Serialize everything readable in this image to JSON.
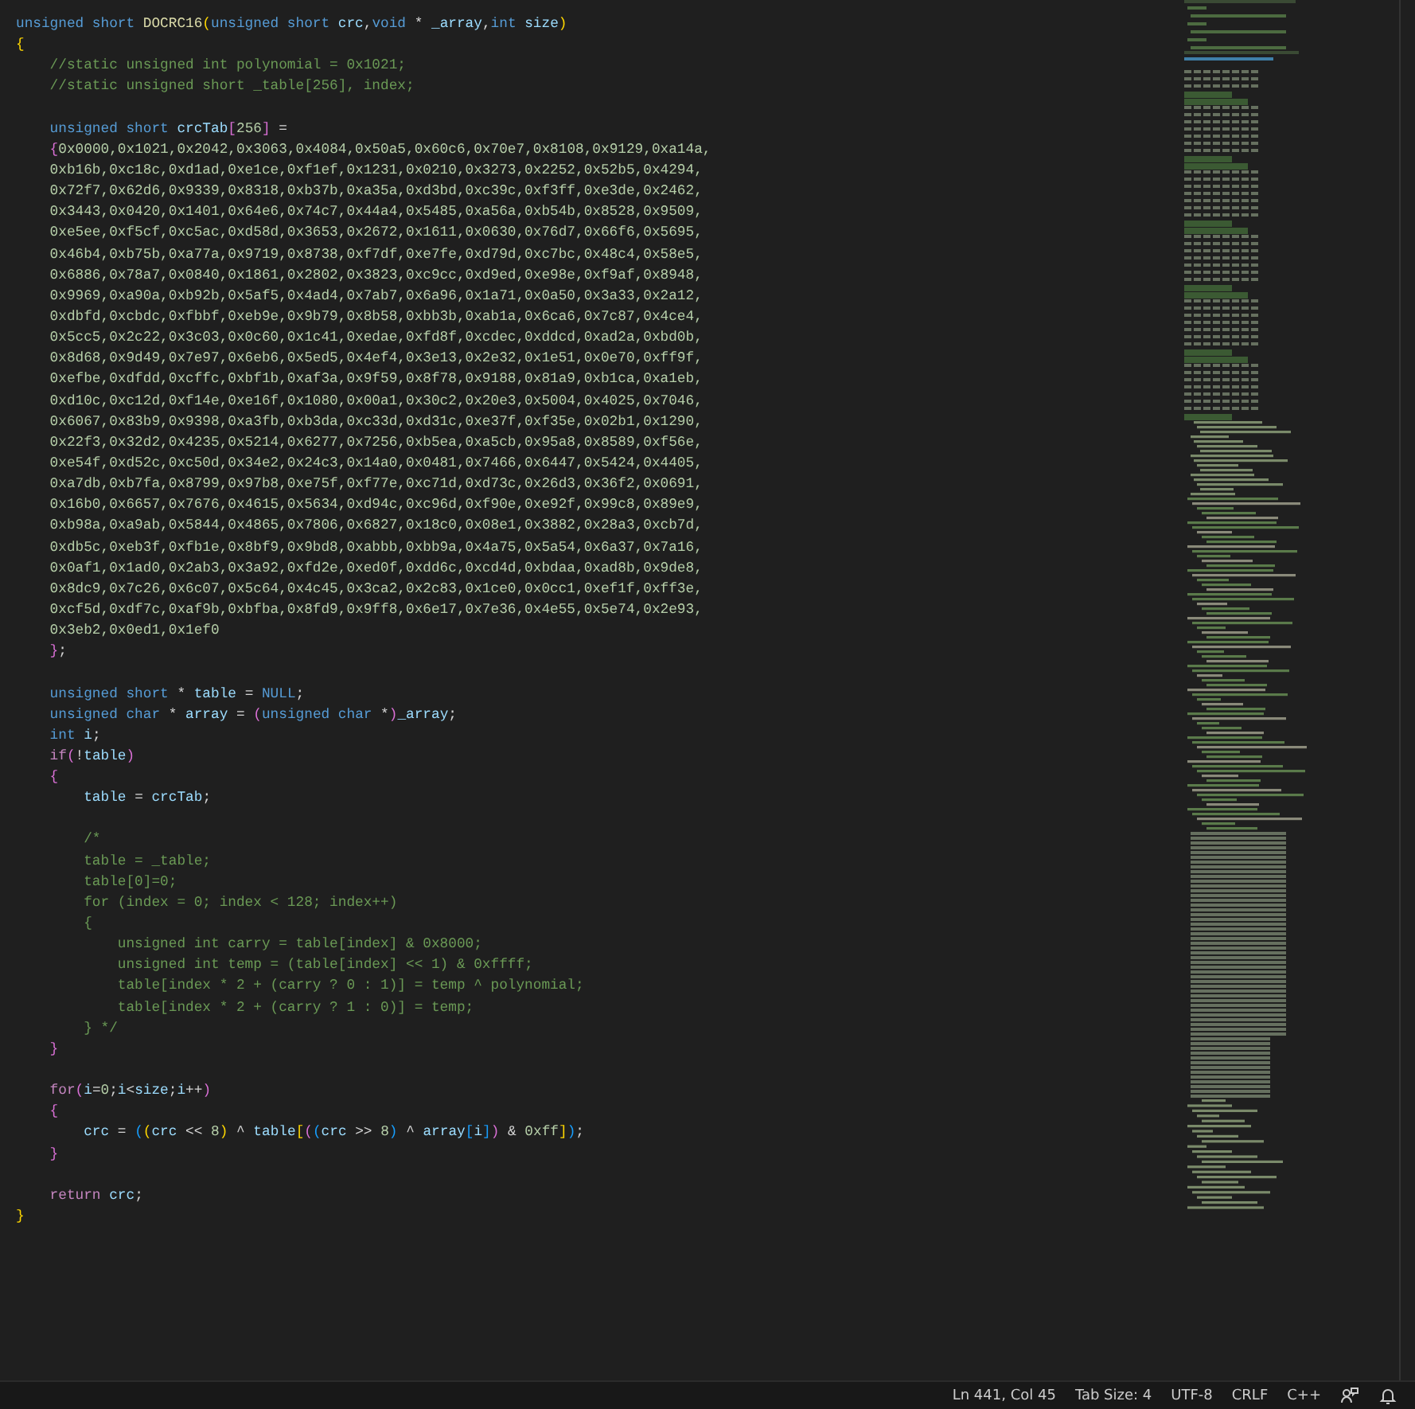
{
  "editor": {
    "lines": [
      {
        "kind": "code",
        "tokens": [
          {
            "kind": "kw",
            "text": "unsigned short "
          },
          {
            "kind": "fn",
            "text": "DOCRC16"
          },
          {
            "kind": "b1",
            "text": "("
          },
          {
            "kind": "kw",
            "text": "unsigned short "
          },
          {
            "kind": "var",
            "text": "crc"
          },
          {
            "kind": "op",
            "text": ","
          },
          {
            "kind": "kw",
            "text": "void"
          },
          {
            "kind": "op",
            "text": " * "
          },
          {
            "kind": "var",
            "text": "_array"
          },
          {
            "kind": "op",
            "text": ","
          },
          {
            "kind": "kw",
            "text": "int "
          },
          {
            "kind": "var",
            "text": "size"
          },
          {
            "kind": "b1",
            "text": ")"
          }
        ]
      },
      {
        "kind": "code",
        "tokens": [
          {
            "kind": "b1",
            "text": "{"
          }
        ]
      },
      {
        "kind": "code",
        "tokens": [
          {
            "kind": "cm",
            "text": "    //static unsigned int polynomial = 0x1021;"
          }
        ]
      },
      {
        "kind": "code",
        "tokens": [
          {
            "kind": "cm",
            "text": "    //static unsigned short _table[256], index;"
          }
        ]
      },
      {
        "kind": "blank"
      },
      {
        "kind": "code",
        "tokens": [
          {
            "kind": "kw",
            "text": "    unsigned short "
          },
          {
            "kind": "var",
            "text": "crcTab"
          },
          {
            "kind": "b2",
            "text": "["
          },
          {
            "kind": "num",
            "text": "256"
          },
          {
            "kind": "b2",
            "text": "]"
          },
          {
            "kind": "op",
            "text": " ="
          }
        ]
      },
      {
        "kind": "code",
        "tokens": [
          {
            "kind": "b2",
            "text": "    {"
          },
          {
            "kind": "num",
            "text": "0x0000,0x1021,0x2042,0x3063,0x4084,0x50a5,0x60c6,0x70e7,0x8108,0x9129,0xa14a,"
          }
        ]
      },
      {
        "kind": "code",
        "tokens": [
          {
            "kind": "num",
            "text": "    0xb16b,0xc18c,0xd1ad,0xe1ce,0xf1ef,0x1231,0x0210,0x3273,0x2252,0x52b5,0x4294,"
          }
        ]
      },
      {
        "kind": "code",
        "tokens": [
          {
            "kind": "num",
            "text": "    0x72f7,0x62d6,0x9339,0x8318,0xb37b,0xa35a,0xd3bd,0xc39c,0xf3ff,0xe3de,0x2462,"
          }
        ]
      },
      {
        "kind": "code",
        "tokens": [
          {
            "kind": "num",
            "text": "    0x3443,0x0420,0x1401,0x64e6,0x74c7,0x44a4,0x5485,0xa56a,0xb54b,0x8528,0x9509,"
          }
        ]
      },
      {
        "kind": "code",
        "tokens": [
          {
            "kind": "num",
            "text": "    0xe5ee,0xf5cf,0xc5ac,0xd58d,0x3653,0x2672,0x1611,0x0630,0x76d7,0x66f6,0x5695,"
          }
        ]
      },
      {
        "kind": "code",
        "tokens": [
          {
            "kind": "num",
            "text": "    0x46b4,0xb75b,0xa77a,0x9719,0x8738,0xf7df,0xe7fe,0xd79d,0xc7bc,0x48c4,0x58e5,"
          }
        ]
      },
      {
        "kind": "code",
        "tokens": [
          {
            "kind": "num",
            "text": "    0x6886,0x78a7,0x0840,0x1861,0x2802,0x3823,0xc9cc,0xd9ed,0xe98e,0xf9af,0x8948,"
          }
        ]
      },
      {
        "kind": "code",
        "tokens": [
          {
            "kind": "num",
            "text": "    0x9969,0xa90a,0xb92b,0x5af5,0x4ad4,0x7ab7,0x6a96,0x1a71,0x0a50,0x3a33,0x2a12,"
          }
        ]
      },
      {
        "kind": "code",
        "tokens": [
          {
            "kind": "num",
            "text": "    0xdbfd,0xcbdc,0xfbbf,0xeb9e,0x9b79,0x8b58,0xbb3b,0xab1a,0x6ca6,0x7c87,0x4ce4,"
          }
        ]
      },
      {
        "kind": "code",
        "tokens": [
          {
            "kind": "num",
            "text": "    0x5cc5,0x2c22,0x3c03,0x0c60,0x1c41,0xedae,0xfd8f,0xcdec,0xddcd,0xad2a,0xbd0b,"
          }
        ]
      },
      {
        "kind": "code",
        "tokens": [
          {
            "kind": "num",
            "text": "    0x8d68,0x9d49,0x7e97,0x6eb6,0x5ed5,0x4ef4,0x3e13,0x2e32,0x1e51,0x0e70,0xff9f,"
          }
        ]
      },
      {
        "kind": "code",
        "tokens": [
          {
            "kind": "num",
            "text": "    0xefbe,0xdfdd,0xcffc,0xbf1b,0xaf3a,0x9f59,0x8f78,0x9188,0x81a9,0xb1ca,0xa1eb,"
          }
        ]
      },
      {
        "kind": "code",
        "tokens": [
          {
            "kind": "num",
            "text": "    0xd10c,0xc12d,0xf14e,0xe16f,0x1080,0x00a1,0x30c2,0x20e3,0x5004,0x4025,0x7046,"
          }
        ]
      },
      {
        "kind": "code",
        "tokens": [
          {
            "kind": "num",
            "text": "    0x6067,0x83b9,0x9398,0xa3fb,0xb3da,0xc33d,0xd31c,0xe37f,0xf35e,0x02b1,0x1290,"
          }
        ]
      },
      {
        "kind": "code",
        "tokens": [
          {
            "kind": "num",
            "text": "    0x22f3,0x32d2,0x4235,0x5214,0x6277,0x7256,0xb5ea,0xa5cb,0x95a8,0x8589,0xf56e,"
          }
        ]
      },
      {
        "kind": "code",
        "tokens": [
          {
            "kind": "num",
            "text": "    0xe54f,0xd52c,0xc50d,0x34e2,0x24c3,0x14a0,0x0481,0x7466,0x6447,0x5424,0x4405,"
          }
        ]
      },
      {
        "kind": "code",
        "tokens": [
          {
            "kind": "num",
            "text": "    0xa7db,0xb7fa,0x8799,0x97b8,0xe75f,0xf77e,0xc71d,0xd73c,0x26d3,0x36f2,0x0691,"
          }
        ]
      },
      {
        "kind": "code",
        "tokens": [
          {
            "kind": "num",
            "text": "    0x16b0,0x6657,0x7676,0x4615,0x5634,0xd94c,0xc96d,0xf90e,0xe92f,0x99c8,0x89e9,"
          }
        ]
      },
      {
        "kind": "code",
        "tokens": [
          {
            "kind": "num",
            "text": "    0xb98a,0xa9ab,0x5844,0x4865,0x7806,0x6827,0x18c0,0x08e1,0x3882,0x28a3,0xcb7d,"
          }
        ]
      },
      {
        "kind": "code",
        "tokens": [
          {
            "kind": "num",
            "text": "    0xdb5c,0xeb3f,0xfb1e,0x8bf9,0x9bd8,0xabbb,0xbb9a,0x4a75,0x5a54,0x6a37,0x7a16,"
          }
        ]
      },
      {
        "kind": "code",
        "tokens": [
          {
            "kind": "num",
            "text": "    0x0af1,0x1ad0,0x2ab3,0x3a92,0xfd2e,0xed0f,0xdd6c,0xcd4d,0xbdaa,0xad8b,0x9de8,"
          }
        ]
      },
      {
        "kind": "code",
        "tokens": [
          {
            "kind": "num",
            "text": "    0x8dc9,0x7c26,0x6c07,0x5c64,0x4c45,0x3ca2,0x2c83,0x1ce0,0x0cc1,0xef1f,0xff3e,"
          }
        ]
      },
      {
        "kind": "code",
        "tokens": [
          {
            "kind": "num",
            "text": "    0xcf5d,0xdf7c,0xaf9b,0xbfba,0x8fd9,0x9ff8,0x6e17,0x7e36,0x4e55,0x5e74,0x2e93,"
          }
        ]
      },
      {
        "kind": "code",
        "tokens": [
          {
            "kind": "num",
            "text": "    0x3eb2,0x0ed1,0x1ef0"
          }
        ]
      },
      {
        "kind": "code",
        "tokens": [
          {
            "kind": "b2",
            "text": "    }"
          },
          {
            "kind": "op",
            "text": ";"
          }
        ]
      },
      {
        "kind": "blank"
      },
      {
        "kind": "code",
        "tokens": [
          {
            "kind": "kw",
            "text": "    unsigned short"
          },
          {
            "kind": "op",
            "text": " * "
          },
          {
            "kind": "var",
            "text": "table"
          },
          {
            "kind": "op",
            "text": " = "
          },
          {
            "kind": "kw",
            "text": "NULL"
          },
          {
            "kind": "op",
            "text": ";"
          }
        ]
      },
      {
        "kind": "code",
        "tokens": [
          {
            "kind": "kw",
            "text": "    unsigned char"
          },
          {
            "kind": "op",
            "text": " * "
          },
          {
            "kind": "var",
            "text": "array"
          },
          {
            "kind": "op",
            "text": " = "
          },
          {
            "kind": "b2",
            "text": "("
          },
          {
            "kind": "kw",
            "text": "unsigned char "
          },
          {
            "kind": "op",
            "text": "*"
          },
          {
            "kind": "b2",
            "text": ")"
          },
          {
            "kind": "var",
            "text": "_array"
          },
          {
            "kind": "op",
            "text": ";"
          }
        ]
      },
      {
        "kind": "code",
        "tokens": [
          {
            "kind": "kw",
            "text": "    int "
          },
          {
            "kind": "var",
            "text": "i"
          },
          {
            "kind": "op",
            "text": ";"
          }
        ]
      },
      {
        "kind": "code",
        "tokens": [
          {
            "kind": "ctl",
            "text": "    if"
          },
          {
            "kind": "b2",
            "text": "("
          },
          {
            "kind": "op",
            "text": "!"
          },
          {
            "kind": "var",
            "text": "table"
          },
          {
            "kind": "b2",
            "text": ")"
          }
        ]
      },
      {
        "kind": "code",
        "tokens": [
          {
            "kind": "b2",
            "text": "    {"
          }
        ]
      },
      {
        "kind": "code",
        "tokens": [
          {
            "kind": "var",
            "text": "        table"
          },
          {
            "kind": "op",
            "text": " = "
          },
          {
            "kind": "var",
            "text": "crcTab"
          },
          {
            "kind": "op",
            "text": ";"
          }
        ]
      },
      {
        "kind": "blank"
      },
      {
        "kind": "code",
        "tokens": [
          {
            "kind": "cm",
            "text": "        /*"
          }
        ]
      },
      {
        "kind": "code",
        "tokens": [
          {
            "kind": "cm",
            "text": "        table = _table;"
          }
        ]
      },
      {
        "kind": "code",
        "tokens": [
          {
            "kind": "cm",
            "text": "        table[0]=0;"
          }
        ]
      },
      {
        "kind": "code",
        "tokens": [
          {
            "kind": "cm",
            "text": "        for (index = 0; index < 128; index++)"
          }
        ]
      },
      {
        "kind": "code",
        "tokens": [
          {
            "kind": "cm",
            "text": "        {"
          }
        ]
      },
      {
        "kind": "code",
        "tokens": [
          {
            "kind": "cm",
            "text": "            unsigned int carry = table[index] & 0x8000;"
          }
        ]
      },
      {
        "kind": "code",
        "tokens": [
          {
            "kind": "cm",
            "text": "            unsigned int temp = (table[index] << 1) & 0xffff;"
          }
        ]
      },
      {
        "kind": "code",
        "tokens": [
          {
            "kind": "cm",
            "text": "            table[index * 2 + (carry ? 0 : 1)] = temp ^ polynomial;"
          }
        ]
      },
      {
        "kind": "code",
        "tokens": [
          {
            "kind": "cm",
            "text": "            table[index * 2 + (carry ? 1 : 0)] = temp;"
          }
        ]
      },
      {
        "kind": "code",
        "tokens": [
          {
            "kind": "cm",
            "text": "        } */"
          }
        ]
      },
      {
        "kind": "code",
        "tokens": [
          {
            "kind": "b2",
            "text": "    }"
          }
        ]
      },
      {
        "kind": "blank"
      },
      {
        "kind": "code",
        "tokens": [
          {
            "kind": "ctl",
            "text": "    for"
          },
          {
            "kind": "b2",
            "text": "("
          },
          {
            "kind": "var",
            "text": "i"
          },
          {
            "kind": "op",
            "text": "="
          },
          {
            "kind": "num",
            "text": "0"
          },
          {
            "kind": "op",
            "text": ";"
          },
          {
            "kind": "var",
            "text": "i"
          },
          {
            "kind": "op",
            "text": "<"
          },
          {
            "kind": "var",
            "text": "size"
          },
          {
            "kind": "op",
            "text": ";"
          },
          {
            "kind": "var",
            "text": "i"
          },
          {
            "kind": "op",
            "text": "++"
          },
          {
            "kind": "b2",
            "text": ")"
          }
        ]
      },
      {
        "kind": "code",
        "tokens": [
          {
            "kind": "b2",
            "text": "    {"
          }
        ]
      },
      {
        "kind": "code",
        "tokens": [
          {
            "kind": "var",
            "text": "        crc"
          },
          {
            "kind": "op",
            "text": " = "
          },
          {
            "kind": "b3",
            "text": "("
          },
          {
            "kind": "b1",
            "text": "("
          },
          {
            "kind": "var",
            "text": "crc"
          },
          {
            "kind": "op",
            "text": " << "
          },
          {
            "kind": "num",
            "text": "8"
          },
          {
            "kind": "b1",
            "text": ")"
          },
          {
            "kind": "op",
            "text": " ^ "
          },
          {
            "kind": "var",
            "text": "table"
          },
          {
            "kind": "b1",
            "text": "["
          },
          {
            "kind": "b2",
            "text": "("
          },
          {
            "kind": "b3",
            "text": "("
          },
          {
            "kind": "var",
            "text": "crc"
          },
          {
            "kind": "op",
            "text": " >> "
          },
          {
            "kind": "num",
            "text": "8"
          },
          {
            "kind": "b3",
            "text": ")"
          },
          {
            "kind": "op",
            "text": " ^ "
          },
          {
            "kind": "var",
            "text": "array"
          },
          {
            "kind": "b3",
            "text": "["
          },
          {
            "kind": "var",
            "text": "i"
          },
          {
            "kind": "b3",
            "text": "]"
          },
          {
            "kind": "b2",
            "text": ")"
          },
          {
            "kind": "op",
            "text": " & "
          },
          {
            "kind": "num",
            "text": "0xff"
          },
          {
            "kind": "b1",
            "text": "]"
          },
          {
            "kind": "b3",
            "text": ")"
          },
          {
            "kind": "op",
            "text": ";"
          }
        ]
      },
      {
        "kind": "code",
        "tokens": [
          {
            "kind": "b2",
            "text": "    }"
          }
        ]
      },
      {
        "kind": "blank"
      },
      {
        "kind": "code",
        "tokens": [
          {
            "kind": "ctl",
            "text": "    return "
          },
          {
            "kind": "var",
            "text": "crc"
          },
          {
            "kind": "op",
            "text": ";"
          }
        ]
      },
      {
        "kind": "code",
        "tokens": [
          {
            "kind": "b1",
            "text": "}"
          }
        ]
      }
    ]
  },
  "status_bar": {
    "items": [
      {
        "kind": "text",
        "label": "Ln 441, Col 45"
      },
      {
        "kind": "text",
        "label": "Tab Size: 4"
      },
      {
        "kind": "text",
        "label": "UTF-8"
      },
      {
        "kind": "text",
        "label": "CRLF"
      },
      {
        "kind": "text",
        "label": "C++"
      },
      {
        "kind": "feedback"
      },
      {
        "kind": "bell"
      }
    ]
  }
}
